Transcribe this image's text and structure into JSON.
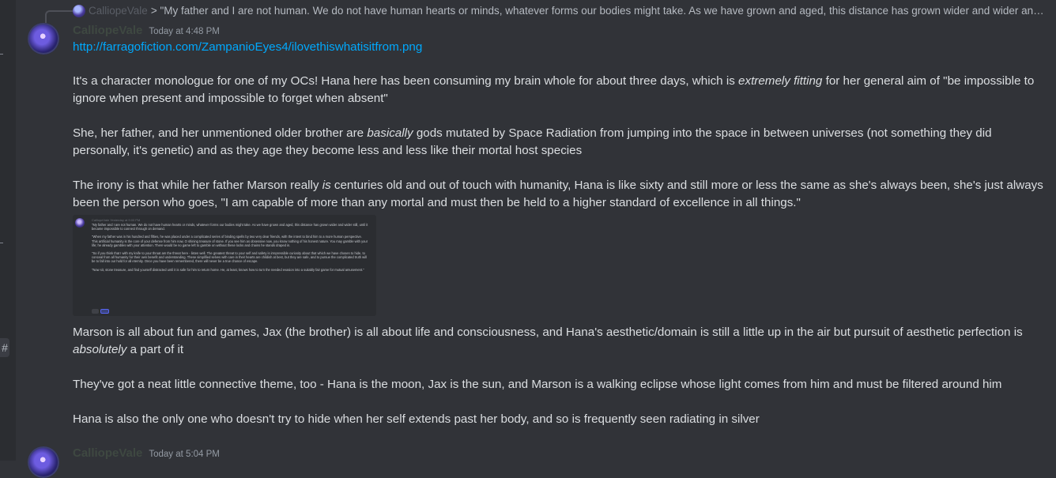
{
  "reply": {
    "author": "CalliopeVale",
    "text": "> \"My father and I are not human. We do not have human hearts or minds, whatever forms our bodies might take. As we have grown and aged, this distance has grown wider and wider and wi..."
  },
  "message1": {
    "author": "CalliopeVale",
    "timestamp": "Today at 4:48 PM",
    "link": "http://farragofiction.com/ZampanioEyes4/ilovethiswhatisitfrom.png",
    "p1_a": "It's a character monologue for one of my OCs! Hana here has been consuming my brain whole for about three days, which is ",
    "p1_em": "extremely fitting",
    "p1_b": " for her general aim of \"be impossible to ignore when present and impossible to forget when absent\"",
    "p2_a": "She, her father, and her unmentioned older brother are ",
    "p2_em": "basically",
    "p2_b": " gods mutated by Space Radiation from jumping into the space in between universes (not something they did personally, it's genetic) and as they age they become less and less like their mortal host species",
    "p3_a": "The irony is that while her father Marson really ",
    "p3_em": "is",
    "p3_b": " centuries old and out of touch with humanity, Hana is like sixty and still more or less the same as she's always been, she's just always been the person who goes, \"I am capable of more than any mortal and must then be held to a higher standard of excellence in all things.\"",
    "p4_a": "Marson is all about fun and games, Jax (the brother) is all about life and consciousness, and Hana's aesthetic/domain is still a little up in the air but pursuit of aesthetic perfection is ",
    "p4_em": "absolutely",
    "p4_b": " a part of it",
    "p5": "They've got a neat little connective theme, too - Hana is the moon, Jax is the sun, and Marson is a walking eclipse whose light comes from him and must be filtered around him",
    "p6": "Hana is also the only one who doesn't try to hide when her self extends past her body, and so is frequently seen radiating in silver"
  },
  "embed": {
    "header": "CalliopeVale   Yesterday at 9:00 PM",
    "paragraphs": [
      "\"My father and I are not human. We do not have human hearts or minds, whatever forms our bodies might take. As we have grown and aged, this distance has grown wider and wider still, until it became impossible to connect through on demand.",
      "\"When my father was in his hundred and fifties, he was placed under a complicated series of binding spells by two very dear friends, with the intent to bind him to a more human perspective. This artificial humanity is the core of your defense from him now, O shining treasure of stone. If you see him as obsessive now, you know nothing of his honest nature. You may gamble with your life; he already gambles with your attention. There would be no game left to gamble on without these locks and chains he stands draped in.",
      "\"So if you think that I with my knife to your throat am the threat here - listen well. The greatest threat to your self and safety is irrepressible curiosity about that which we have chosen to hide, to conceal from all humanity for their own benefit and understanding. These simplified selves with care in their hearts are childish at best, but they are safe, and to pursue the complicated truth will be to fall into our hold for all eternity. Once you have been remembered, there will never be a true chance of escape.",
      "\"Now sit, stone treasure, and find yourself distracted until it is safe for him to return home. He, at least, knows how to turn the needed evasion into a suitably fair game for mutual amusement.\""
    ]
  },
  "message2": {
    "author": "CalliopeVale",
    "timestamp": "Today at 5:04 PM"
  }
}
